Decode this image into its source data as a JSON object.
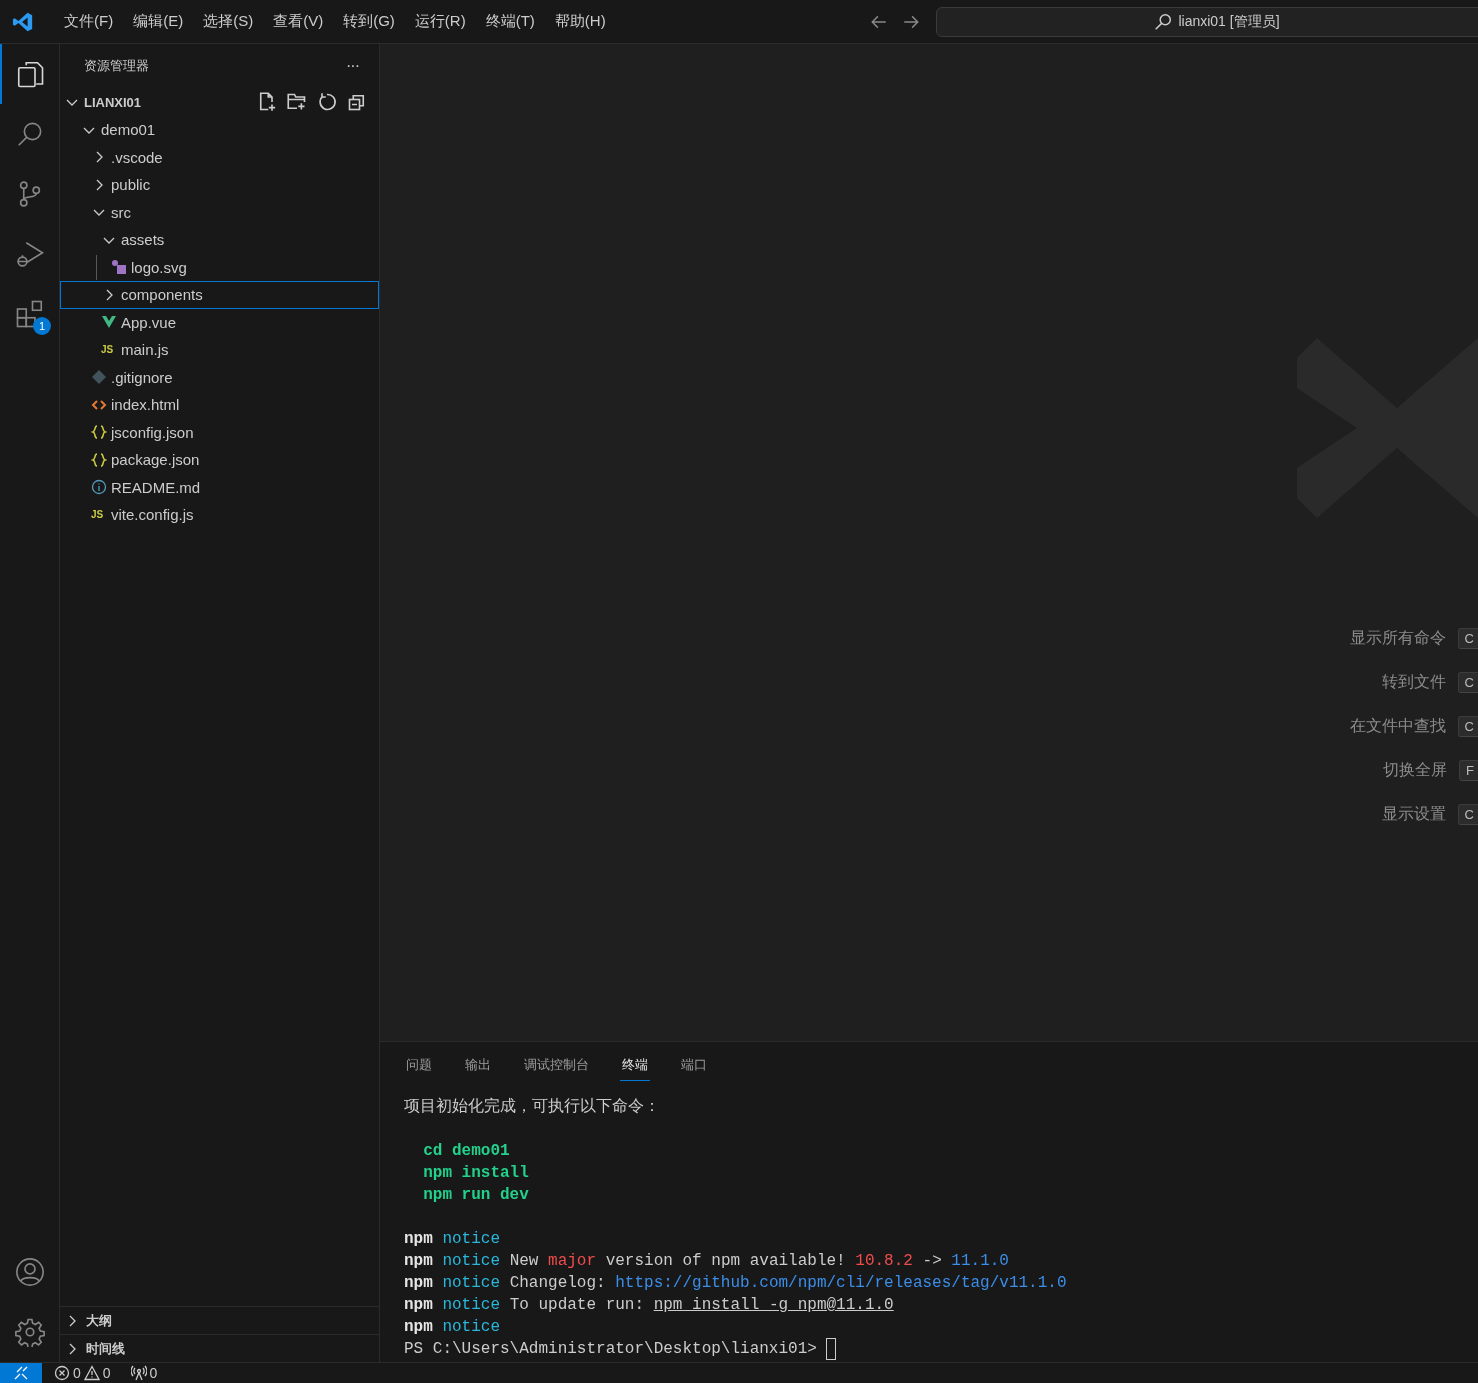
{
  "menu": [
    "文件(F)",
    "编辑(E)",
    "选择(S)",
    "查看(V)",
    "转到(G)",
    "运行(R)",
    "终端(T)",
    "帮助(H)"
  ],
  "command_center": {
    "text": "lianxi01 [管理员]"
  },
  "activity_bar": [
    {
      "kind": "explorer",
      "selected": true
    },
    {
      "kind": "search",
      "selected": false
    },
    {
      "kind": "source-control",
      "selected": false
    },
    {
      "kind": "run-debug",
      "selected": false
    },
    {
      "kind": "extensions",
      "selected": false,
      "badge": "1"
    }
  ],
  "activity_bottom": [
    {
      "kind": "account"
    },
    {
      "kind": "settings"
    }
  ],
  "sidebar": {
    "title": "资源管理器",
    "more": "···",
    "root": {
      "label": "LIANXI01",
      "expanded": true
    },
    "tree": [
      {
        "label": "demo01",
        "kind": "folder",
        "expanded": true,
        "selected": false,
        "children": [
          {
            "label": ".vscode",
            "kind": "folder",
            "expanded": false,
            "selected": false
          },
          {
            "label": "public",
            "kind": "folder",
            "expanded": false,
            "selected": false
          },
          {
            "label": "src",
            "kind": "folder",
            "expanded": true,
            "selected": false,
            "children": [
              {
                "label": "assets",
                "kind": "folder",
                "expanded": true,
                "selected": false,
                "children": [
                  {
                    "label": "logo.svg",
                    "kind": "svg",
                    "selected": false
                  }
                ]
              },
              {
                "label": "components",
                "kind": "folder",
                "expanded": false,
                "selected": true
              },
              {
                "label": "App.vue",
                "kind": "vue",
                "selected": false
              },
              {
                "label": "main.js",
                "kind": "js",
                "icon_text": "JS",
                "selected": false
              }
            ]
          },
          {
            "label": ".gitignore",
            "kind": "git",
            "selected": false
          },
          {
            "label": "index.html",
            "kind": "html",
            "selected": false
          },
          {
            "label": "jsconfig.json",
            "kind": "json",
            "selected": false
          },
          {
            "label": "package.json",
            "kind": "json",
            "selected": false
          },
          {
            "label": "README.md",
            "kind": "info",
            "selected": false
          },
          {
            "label": "vite.config.js",
            "kind": "js",
            "icon_text": "JS",
            "selected": false
          }
        ]
      }
    ],
    "sections": [
      {
        "label": "大纲",
        "expanded": false
      },
      {
        "label": "时间线",
        "expanded": false
      }
    ]
  },
  "editor": {
    "shortcuts": [
      {
        "label": "显示所有命令",
        "key": "C"
      },
      {
        "label": "转到文件",
        "key": "C"
      },
      {
        "label": "在文件中查找",
        "key": "C"
      },
      {
        "label": "切换全屏",
        "key": "F"
      },
      {
        "label": "显示设置",
        "key": "C"
      }
    ]
  },
  "panel": {
    "tabs": [
      {
        "label": "问题",
        "selected": false
      },
      {
        "label": "输出",
        "selected": false
      },
      {
        "label": "调试控制台",
        "selected": false
      },
      {
        "label": "终端",
        "selected": true
      },
      {
        "label": "端口",
        "selected": false
      }
    ],
    "terminal": [
      {
        "segments": [
          {
            "kind": "plain",
            "text": "项目初始化完成，可执行以下命令："
          }
        ]
      },
      {
        "gap_before": true,
        "segments": [
          {
            "kind": "green",
            "text": "  cd demo01"
          }
        ]
      },
      {
        "segments": [
          {
            "kind": "green",
            "text": "  npm install"
          }
        ]
      },
      {
        "segments": [
          {
            "kind": "green",
            "text": "  npm run dev"
          }
        ]
      },
      {
        "gap_before": true,
        "segments": [
          {
            "kind": "bold",
            "text": "npm"
          },
          {
            "kind": "cyan",
            "text": " notice"
          }
        ]
      },
      {
        "segments": [
          {
            "kind": "bold",
            "text": "npm"
          },
          {
            "kind": "cyan",
            "text": " notice"
          },
          {
            "kind": "plain",
            "text": " New "
          },
          {
            "kind": "red",
            "text": "major"
          },
          {
            "kind": "plain",
            "text": " version of npm available! "
          },
          {
            "kind": "red",
            "text": "10.8.2"
          },
          {
            "kind": "plain",
            "text": " -> "
          },
          {
            "kind": "blue",
            "text": "11.1.0"
          }
        ]
      },
      {
        "segments": [
          {
            "kind": "bold",
            "text": "npm"
          },
          {
            "kind": "cyan",
            "text": " notice"
          },
          {
            "kind": "plain",
            "text": " Changelog: "
          },
          {
            "kind": "blue",
            "text": "https://github.com/npm/cli/releases/tag/v11.1.0"
          }
        ]
      },
      {
        "segments": [
          {
            "kind": "bold",
            "text": "npm"
          },
          {
            "kind": "cyan",
            "text": " notice"
          },
          {
            "kind": "plain",
            "text": " To update run: "
          },
          {
            "kind": "underline",
            "text": "npm install -g npm@11.1.0"
          }
        ]
      },
      {
        "segments": [
          {
            "kind": "bold",
            "text": "npm"
          },
          {
            "kind": "cyan",
            "text": " notice"
          }
        ]
      },
      {
        "segments": [
          {
            "kind": "plain",
            "text": "PS C:\\Users\\Administrator\\Desktop\\lianxi01> "
          },
          {
            "kind": "cursor"
          }
        ]
      }
    ]
  },
  "status_bar": {
    "errors": "0",
    "warnings": "0",
    "ports": "0"
  }
}
